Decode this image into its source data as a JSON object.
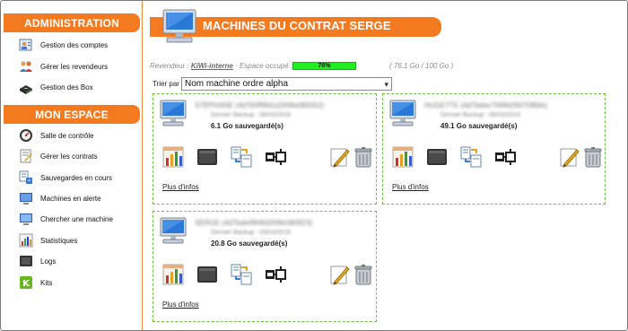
{
  "sidebar": {
    "admin_title": "ADMINISTRATION",
    "admin_items": [
      {
        "label": "Gestion des comptes",
        "icon": "accounts-icon"
      },
      {
        "label": "Gérer les revendeurs",
        "icon": "resellers-icon"
      },
      {
        "label": "Gestion des Box",
        "icon": "box-icon"
      }
    ],
    "space_title": "MON ESPACE",
    "space_items": [
      {
        "label": "Salle de contrôle",
        "icon": "dashboard-icon"
      },
      {
        "label": "Gérer les contrats",
        "icon": "contract-icon"
      },
      {
        "label": "Sauvegardes en cours",
        "icon": "backup-progress-icon"
      },
      {
        "label": "Machines en alerte",
        "icon": "alert-machine-icon"
      },
      {
        "label": "Chercher une machine",
        "icon": "search-machine-icon"
      },
      {
        "label": "Statistiques",
        "icon": "stats-icon"
      },
      {
        "label": "Logs",
        "icon": "logs-icon"
      },
      {
        "label": "Kits",
        "icon": "kits-icon"
      }
    ]
  },
  "header": {
    "title": "MACHINES DU CONTRAT SERGE",
    "reseller_prefix": "Revendeur : ",
    "reseller_name": "KiWi-interne",
    "space_label": " - Espace occupé : ",
    "quota_percent_label": "76%",
    "quota_fraction": 0.76,
    "quota_text": "( 76.1 Go / 100 Go )"
  },
  "sort": {
    "label": "Trier par :",
    "selected": "Nom machine ordre alpha"
  },
  "machines": [
    {
      "name": "STEPHANE (4d7b0ff9fd1d269fe080052)",
      "backup": "Dernier Backup : 06/03/2016",
      "saved": "6.1 Go sauvegardé(s)",
      "more": "Plus d'infos"
    },
    {
      "name": "HUGETTE (4d7bdee7f49fd260708bfe)",
      "backup": "Dernier Backup : 06/03/2016",
      "saved": "49.1 Go sauvegardé(s)",
      "more": "Plus d'infos"
    },
    {
      "name": "SERGE (4d7bde09f4fd269fe080823)",
      "backup": "Dernier Backup : 03/03/2016",
      "saved": "20.8 Go sauvegardé(s)",
      "more": "Plus d'infos"
    }
  ],
  "colors": {
    "accent": "#f47a20",
    "quota": "#22ee22",
    "card_border": "#70c040"
  }
}
